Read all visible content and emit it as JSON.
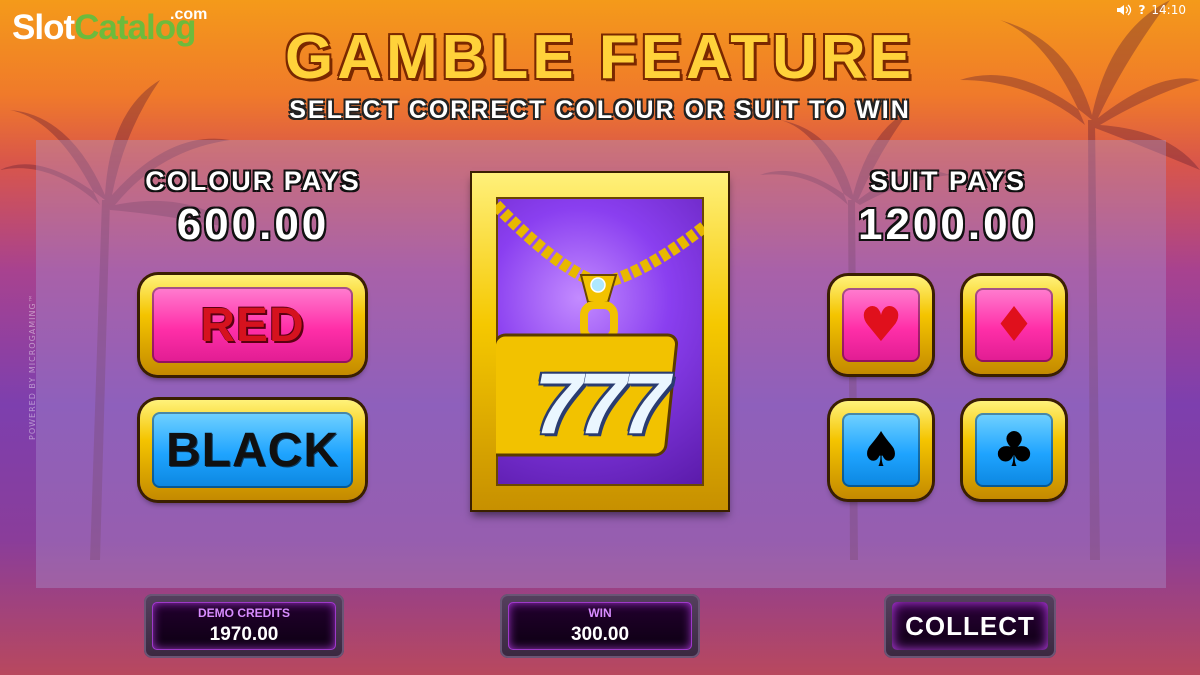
{
  "logo": {
    "part1": "Slot",
    "part2": "Catalog",
    "suffix": ".com"
  },
  "status": {
    "sound_icon": "speaker-icon",
    "help": "?",
    "time": "14:10"
  },
  "header": {
    "title": "GAMBLE FEATURE",
    "subtitle": "SELECT CORRECT COLOUR OR SUIT TO WIN"
  },
  "colour_pays": {
    "label": "COLOUR PAYS",
    "value": "600.00"
  },
  "suit_pays": {
    "label": "SUIT PAYS",
    "value": "1200.00"
  },
  "colour_buttons": {
    "red": "RED",
    "black": "BLACK"
  },
  "suit_buttons": {
    "hearts": "♥",
    "diamonds": "♦",
    "spades": "♠",
    "clubs": "♣",
    "hearts_color": "#e0101c",
    "diamonds_color": "#e0101c",
    "spades_color": "#000000",
    "clubs_color": "#000000"
  },
  "card": {
    "text": "777"
  },
  "powered_by": "POWERED BY MICROGAMING™",
  "meters": {
    "credits_label": "DEMO CREDITS",
    "credits_value": "1970.00",
    "win_label": "WIN",
    "win_value": "300.00"
  },
  "collect_label": "COLLECT",
  "colors": {
    "gold": "#ffd23a",
    "pink_button": "#ff2fa8",
    "blue_button": "#1fa4ff",
    "card_purple": "#8a3ff0"
  }
}
